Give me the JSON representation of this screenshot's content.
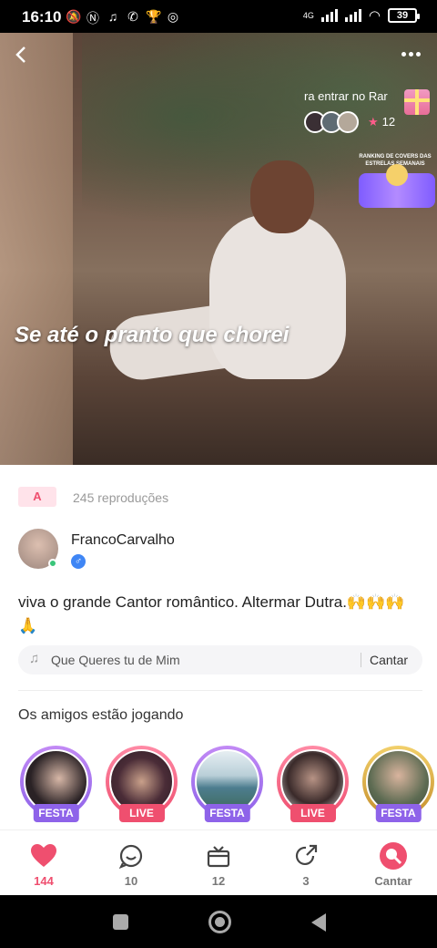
{
  "status_bar": {
    "time": "16:10",
    "network": "4G",
    "battery": "39",
    "icons": [
      "mute-icon",
      "nfc-icon",
      "headphones-icon",
      "whatsapp-icon",
      "trophy-icon",
      "chrome-icon"
    ]
  },
  "video": {
    "lyric": "Se até o pranto que chorei",
    "enter_text": "ra entrar no Rar",
    "stars": "12",
    "ranking_text": "RANKING DE COVERS DAS ESTRELAS SEMANAIS"
  },
  "post": {
    "rank_badge": "A",
    "plays": "245 reproduções",
    "username": "FrancoCarvalho",
    "gender_symbol": "♂",
    "caption": "viva o grande Cantor romântico. Altermar Dutra.🙌🙌🙌🙏",
    "song_name": "Que Queres tu de Mim",
    "sing_label": "Cantar",
    "friends_title": "Os amigos estão jogando"
  },
  "friends": [
    {
      "tag": "FESTA",
      "style": "purple"
    },
    {
      "tag": "LIVE",
      "style": "red"
    },
    {
      "tag": "FESTA",
      "style": "purple"
    },
    {
      "tag": "LIVE",
      "style": "red"
    },
    {
      "tag": "FESTA",
      "style": "purple"
    }
  ],
  "actions": {
    "likes": "144",
    "comments": "10",
    "gifts": "12",
    "shares": "3",
    "sing": "Cantar"
  },
  "colors": {
    "accent": "#ef4f6f",
    "purple": "#8e63e9"
  }
}
